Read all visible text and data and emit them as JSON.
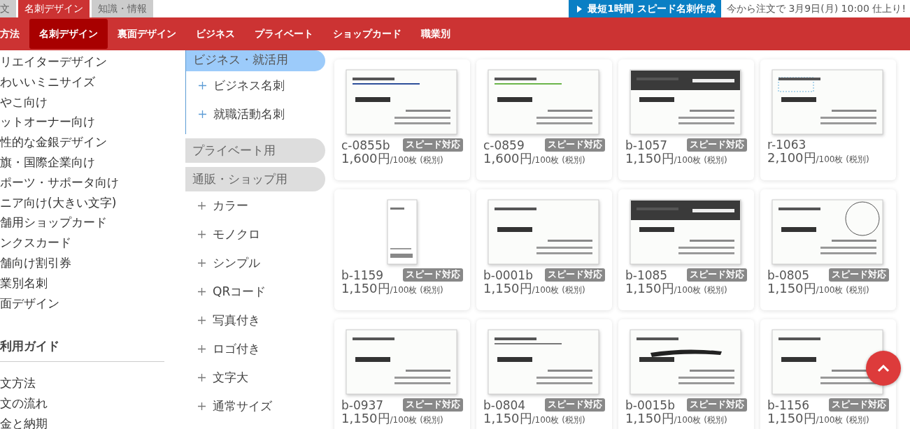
{
  "top_tabs": [
    {
      "label": "文",
      "selected": false
    },
    {
      "label": "名刺デザイン",
      "selected": true
    },
    {
      "label": "知識・情報",
      "selected": false
    }
  ],
  "speed_banner": {
    "button": "最短1時間 スピード名刺作成",
    "notice": "今から注文で 3月9日(月) 10:00 仕上り!"
  },
  "nav": [
    {
      "label": "方法",
      "selected": false
    },
    {
      "label": "名刺デザイン",
      "selected": true
    },
    {
      "label": "裏面デザイン",
      "selected": false
    },
    {
      "label": "ビジネス",
      "selected": false
    },
    {
      "label": "プライベート",
      "selected": false
    },
    {
      "label": "ショップカード",
      "selected": false
    },
    {
      "label": "職業別",
      "selected": false
    }
  ],
  "side_links": [
    "リエイターデザイン",
    "わいいミニサイズ",
    "やこ向け",
    "ットオーナー向け",
    "性的な金銀デザイン",
    "旗・国際企業向け",
    "ポーツ・サポータ向け",
    "ニア向け(大きい文字)",
    "舗用ショップカード",
    "ンクスカード",
    "舗向け割引券",
    "業別名刺",
    "面デザイン"
  ],
  "guide": {
    "title": "利用ガイド",
    "links": [
      "文方法",
      "文の流れ",
      "金と納期"
    ]
  },
  "categories": [
    {
      "label": "ビジネス・就活用",
      "selected": true,
      "children": [
        {
          "label": "ビジネス名刺"
        },
        {
          "label": "就職活動名刺"
        }
      ]
    },
    {
      "label": "プライベート用",
      "selected": false
    },
    {
      "label": "通販・ショップ用",
      "selected": false,
      "children": [
        {
          "label": "カラー"
        },
        {
          "label": "モノクロ"
        },
        {
          "label": "シンプル"
        },
        {
          "label": "QRコード"
        },
        {
          "label": "写真付き"
        },
        {
          "label": "ロゴ付き"
        },
        {
          "label": "文字大"
        },
        {
          "label": "通常サイズ"
        }
      ]
    }
  ],
  "products": [
    {
      "code": "c-0855b",
      "price": "1,600円",
      "unit": "/100枚 (税別)",
      "badge": "スピード対応"
    },
    {
      "code": "c-0859",
      "price": "1,600円",
      "unit": "/100枚 (税別)",
      "badge": "スピード対応"
    },
    {
      "code": "b-1057",
      "price": "1,150円",
      "unit": "/100枚 (税別)",
      "badge": "スピード対応"
    },
    {
      "code": "r-1063",
      "price": "2,100円",
      "unit": "/100枚 (税別)"
    },
    {
      "code": "b-1159",
      "price": "1,150円",
      "unit": "/100枚 (税別)",
      "badge": "スピード対応"
    },
    {
      "code": "b-0001b",
      "price": "1,150円",
      "unit": "/100枚 (税別)",
      "badge": "スピード対応"
    },
    {
      "code": "b-1085",
      "price": "1,150円",
      "unit": "/100枚 (税別)",
      "badge": "スピード対応"
    },
    {
      "code": "b-0805",
      "price": "1,150円",
      "unit": "/100枚 (税別)",
      "badge": "スピード対応"
    },
    {
      "code": "b-0937",
      "price": "1,150円",
      "unit": "/100枚 (税別)",
      "badge": "スピード対応"
    },
    {
      "code": "b-0804",
      "price": "1,150円",
      "unit": "/100枚 (税別)",
      "badge": "スピード対応"
    },
    {
      "code": "b-0015b",
      "price": "1,150円",
      "unit": "/100枚 (税別)",
      "badge": "スピード対応"
    },
    {
      "code": "b-1156",
      "price": "1,150円",
      "unit": "/100枚 (税別)",
      "badge": "スピード対応"
    }
  ]
}
